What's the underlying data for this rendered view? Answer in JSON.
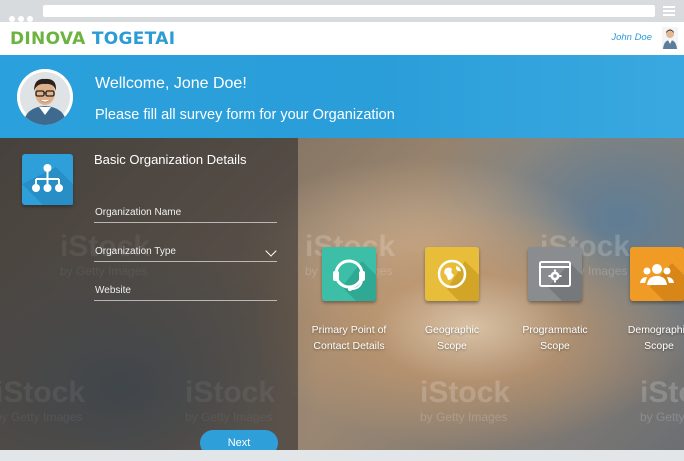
{
  "header": {
    "brand_part1": "DINOVA",
    "brand_part2": "TOGETAI",
    "user_name": "John Doe"
  },
  "welcome": {
    "title": "Wellcome, Jone Doe!",
    "subtitle": "Please fill all survey form for your Organization"
  },
  "form": {
    "title": "Basic Organization Details",
    "fields": [
      {
        "label": "Organization Name"
      },
      {
        "label": "Organization Type"
      },
      {
        "label": "Website"
      }
    ],
    "next_label": "Next"
  },
  "categories": [
    {
      "label_line1": "Primary Point of",
      "label_line2": "Contact Details",
      "icon": "headset-icon",
      "color": "#3dbfa7"
    },
    {
      "label_line1": "Geographic",
      "label_line2": "Scope",
      "icon": "globe-icon",
      "color": "#e8bd3a"
    },
    {
      "label_line1": "Programmatic",
      "label_line2": "Scope",
      "icon": "browser-gear-icon",
      "color": "#8a8d90"
    },
    {
      "label_line1": "Demographic",
      "label_line2": "Scope",
      "icon": "people-icon",
      "color": "#ef9b25"
    }
  ],
  "watermark": {
    "brand": "iStock",
    "sub": "by Getty Images"
  },
  "colors": {
    "accent": "#2a9ed9",
    "brand_green": "#6cb33f"
  }
}
